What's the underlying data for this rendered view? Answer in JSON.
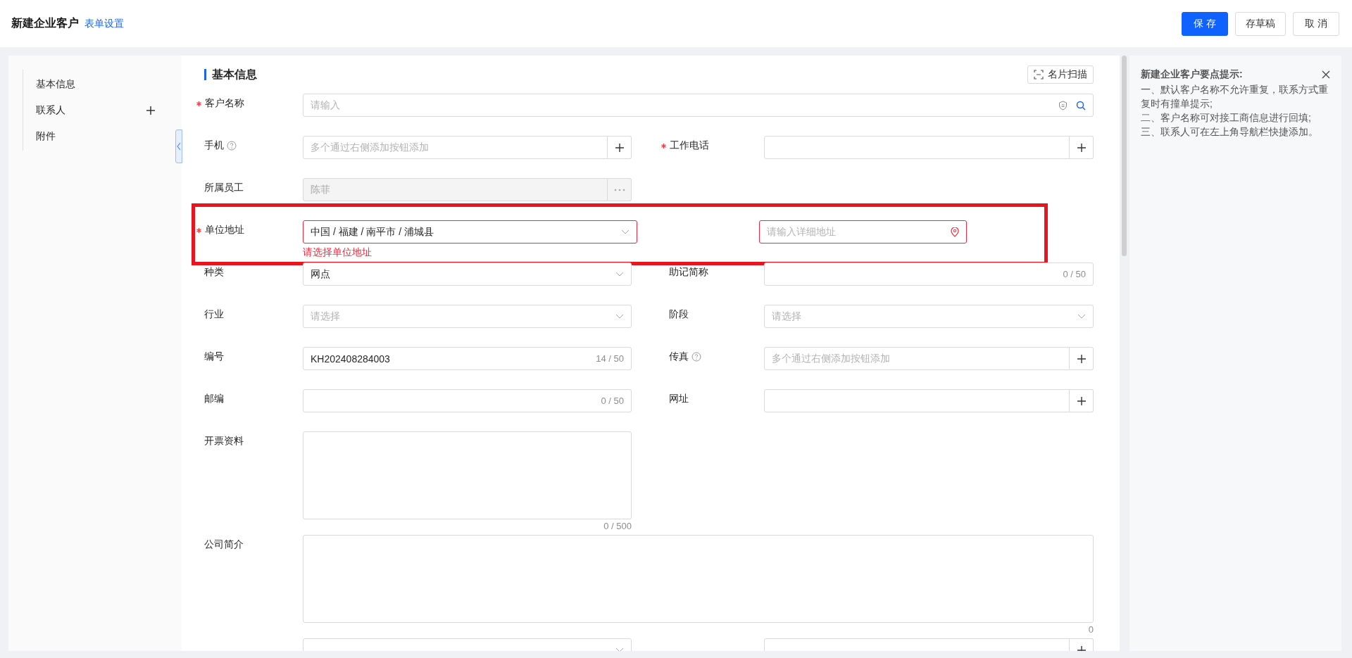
{
  "header": {
    "title": "新建企业客户",
    "link": "表单设置",
    "buttons": [
      {
        "label": "保 存",
        "kind": "primary"
      },
      {
        "label": "存草稿",
        "kind": "default"
      },
      {
        "label": "取 消",
        "kind": "default"
      }
    ]
  },
  "nav": {
    "items": [
      {
        "label": "基本信息",
        "add": false
      },
      {
        "label": "联系人",
        "add": true
      },
      {
        "label": "附件",
        "add": false
      }
    ]
  },
  "section": {
    "title": "基本信息",
    "scan_button": "名片扫描"
  },
  "rows": [
    {
      "highlighted": false,
      "fields": [
        {
          "kind": "search",
          "label": "客户名称",
          "required": true,
          "placeholder": "请输入",
          "wide": true
        }
      ]
    },
    {
      "highlighted": false,
      "fields": [
        {
          "kind": "multi",
          "label": "手机",
          "help": true,
          "placeholder": "多个通过右侧添加按钮添加"
        },
        {
          "kind": "multi",
          "label": "工作电话",
          "required": true
        }
      ]
    },
    {
      "highlighted": false,
      "fields": [
        {
          "kind": "picker",
          "label": "所属员工",
          "value": "陈菲",
          "disabled": true
        }
      ]
    },
    {
      "highlighted": true,
      "fields": [
        {
          "kind": "cascader",
          "label": "单位地址",
          "required": true,
          "value": "中国 / 福建 / 南平市 / 浦城县",
          "invalid": true,
          "error": "请选择单位地址"
        },
        {
          "kind": "location",
          "placeholder": "请输入详细地址",
          "invalid": true
        }
      ]
    },
    {
      "highlighted": false,
      "fields": [
        {
          "kind": "select",
          "label": "种类",
          "value": "网点"
        },
        {
          "kind": "text",
          "label": "助记简称",
          "counter": "0 / 50"
        }
      ]
    },
    {
      "highlighted": false,
      "fields": [
        {
          "kind": "select",
          "label": "行业",
          "placeholder": "请选择"
        },
        {
          "kind": "select",
          "label": "阶段",
          "placeholder": "请选择"
        }
      ]
    },
    {
      "highlighted": false,
      "fields": [
        {
          "kind": "text",
          "label": "编号",
          "value": "KH202408284003",
          "counter": "14 / 50"
        },
        {
          "kind": "multi",
          "label": "传真",
          "help": true,
          "placeholder": "多个通过右侧添加按钮添加"
        }
      ]
    },
    {
      "highlighted": false,
      "fields": [
        {
          "kind": "text",
          "label": "邮编",
          "counter": "0 / 50"
        },
        {
          "kind": "multi",
          "label": "网址"
        }
      ]
    },
    {
      "highlighted": false,
      "fields": [
        {
          "kind": "textarea",
          "label": "开票资料",
          "counter": "0 / 500"
        }
      ]
    },
    {
      "highlighted": false,
      "fields": [
        {
          "kind": "textarea",
          "label": "公司简介",
          "counter": "0",
          "wide": true
        }
      ]
    },
    {
      "highlighted": false,
      "fields": [
        {
          "kind": "select"
        },
        {
          "kind": "multi"
        }
      ]
    }
  ],
  "tips": {
    "title": "新建企业客户要点提示:",
    "lines": [
      "一、默认客户名称不允许重复，联系方式重复时有撞单提示;",
      "二、客户名称可对接工商信息进行回填;",
      "三、联系人可在左上角导航栏快捷添加。"
    ]
  }
}
